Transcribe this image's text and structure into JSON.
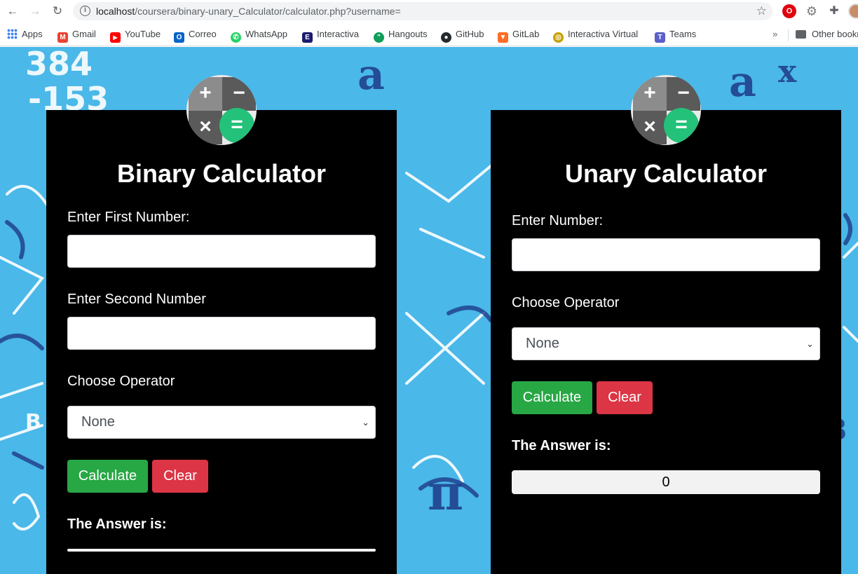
{
  "browser": {
    "url_host": "localhost",
    "url_path": "/coursera/binary-unary_Calculator/calculator.php?username=",
    "bookmarks": [
      {
        "label": "Apps",
        "icon": "apps-grid-icon"
      },
      {
        "label": "Gmail",
        "icon": "gmail-icon",
        "color": "#ea4335",
        "glyph": "M"
      },
      {
        "label": "YouTube",
        "icon": "youtube-icon",
        "color": "#ff0000",
        "glyph": "▶"
      },
      {
        "label": "Correo",
        "icon": "outlook-icon",
        "color": "#0a64c8",
        "glyph": "O"
      },
      {
        "label": "WhatsApp",
        "icon": "whatsapp-icon",
        "color": "#25d366",
        "glyph": "✆"
      },
      {
        "label": "Interactiva",
        "icon": "interactiva-icon",
        "color": "#1a1a6e",
        "glyph": "E"
      },
      {
        "label": "Hangouts",
        "icon": "hangouts-icon",
        "color": "#0f9d58",
        "glyph": "\""
      },
      {
        "label": "GitHub",
        "icon": "github-icon",
        "color": "#24292e",
        "glyph": "●"
      },
      {
        "label": "GitLab",
        "icon": "gitlab-icon",
        "color": "#fc6d26",
        "glyph": "▼"
      },
      {
        "label": "Interactiva Virtual",
        "icon": "interactiva-virtual-icon",
        "color": "#c8a000",
        "glyph": "◎"
      },
      {
        "label": "Teams",
        "icon": "teams-icon",
        "color": "#5b5fc7",
        "glyph": "T"
      }
    ],
    "more_label": "»",
    "other_bookmarks": "Other bookmarks"
  },
  "binary": {
    "title": "Binary Calculator",
    "first_label": "Enter First Number:",
    "second_label": "Enter Second Number",
    "operator_label": "Choose Operator",
    "operator_selected": "None",
    "calculate_label": "Calculate",
    "clear_label": "Clear",
    "answer_label": "The Answer is:",
    "answer_value": ""
  },
  "unary": {
    "title": "Unary Calculator",
    "number_label": "Enter Number:",
    "operator_label": "Choose Operator",
    "operator_selected": "None",
    "calculate_label": "Calculate",
    "clear_label": "Clear",
    "answer_label": "The Answer is:",
    "answer_value": "0"
  },
  "logo": {
    "plus": "+",
    "minus": "−",
    "times": "×",
    "equals": "="
  },
  "colors": {
    "background": "#4ab8e8",
    "card": "#000000",
    "calculate": "#28a745",
    "clear": "#dc3545",
    "logo_equals": "#24c17a"
  }
}
